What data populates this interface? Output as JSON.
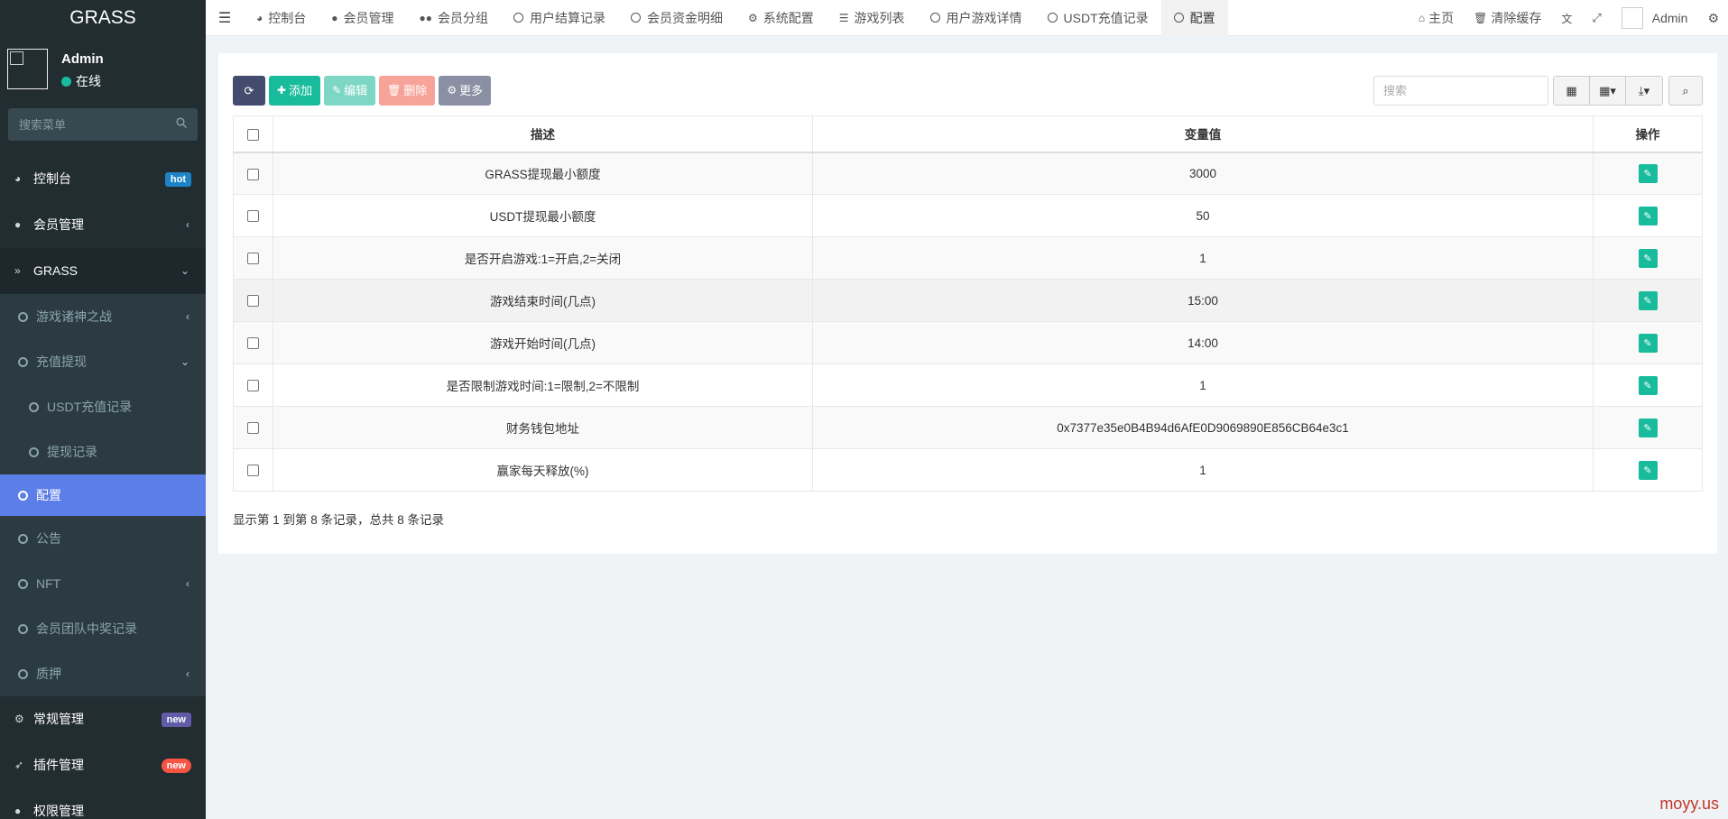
{
  "sidebar": {
    "brand": "GRASS",
    "user": {
      "name": "Admin",
      "status": "在线"
    },
    "search_placeholder": "搜索菜单",
    "items": [
      {
        "label": "控制台",
        "badge": "hot"
      },
      {
        "label": "会员管理"
      },
      {
        "label": "GRASS"
      },
      {
        "label": "游戏诸神之战"
      },
      {
        "label": "充值提现"
      },
      {
        "label": "USDT充值记录"
      },
      {
        "label": "提现记录"
      },
      {
        "label": "配置"
      },
      {
        "label": "公告"
      },
      {
        "label": "NFT"
      },
      {
        "label": "会员团队中奖记录"
      },
      {
        "label": "质押"
      },
      {
        "label": "常规管理",
        "badge": "new"
      },
      {
        "label": "插件管理",
        "badge": "new"
      },
      {
        "label": "权限管理"
      }
    ]
  },
  "topbar": {
    "tabs": [
      "控制台",
      "会员管理",
      "会员分组",
      "用户结算记录",
      "会员资金明细",
      "系统配置",
      "游戏列表",
      "用户游戏详情",
      "USDT充值记录",
      "配置"
    ],
    "right": {
      "home": "主页",
      "clear_cache": "清除缓存",
      "admin": "Admin"
    }
  },
  "toolbar": {
    "add": "添加",
    "edit": "编辑",
    "delete": "删除",
    "more": "更多",
    "search_placeholder": "搜索"
  },
  "table": {
    "headers": {
      "desc": "描述",
      "value": "变量值",
      "action": "操作"
    },
    "rows": [
      {
        "desc": "GRASS提现最小额度",
        "value": "3000"
      },
      {
        "desc": "USDT提现最小额度",
        "value": "50"
      },
      {
        "desc": "是否开启游戏:1=开启,2=关闭",
        "value": "1"
      },
      {
        "desc": "游戏结束时间(几点)",
        "value": "15:00"
      },
      {
        "desc": "游戏开始时间(几点)",
        "value": "14:00"
      },
      {
        "desc": "是否限制游戏时间:1=限制,2=不限制",
        "value": "1"
      },
      {
        "desc": "财务钱包地址",
        "value": "0x7377e35e0B4B94d6AfE0D9069890E856CB64e3c1"
      },
      {
        "desc": "赢家每天释放(%)",
        "value": "1"
      }
    ]
  },
  "pager": "显示第 1 到第 8 条记录，总共 8 条记录",
  "watermark": "moyy.us"
}
